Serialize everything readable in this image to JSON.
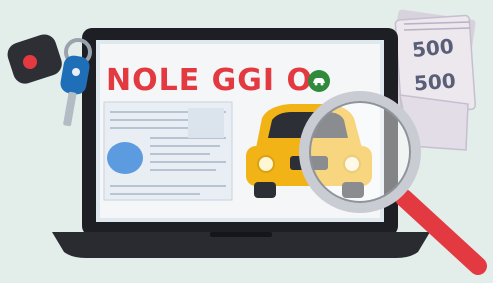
{
  "screen": {
    "title": "NOLE GGI O"
  },
  "banknotes": [
    {
      "value": "500"
    },
    {
      "value": "500"
    }
  ],
  "colors": {
    "background": "#e3edea",
    "laptop_frame": "#1e1f24",
    "screen_paper": "#f4f6f8",
    "title_red": "#e23a40",
    "car_yellow": "#f2b316",
    "magnifier_handle": "#e23a40",
    "key_blue": "#1f6fb8",
    "badge_green": "#2f8a3c"
  }
}
